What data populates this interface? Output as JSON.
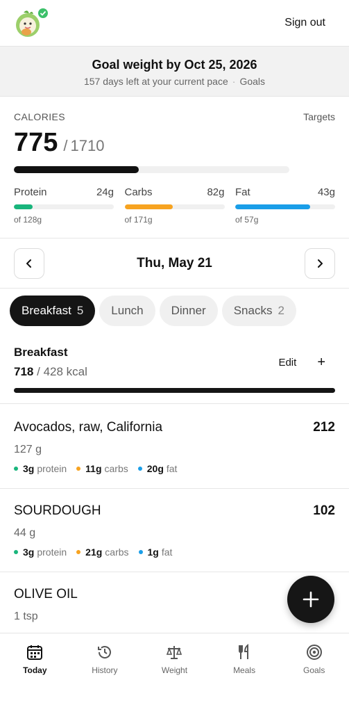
{
  "header": {
    "sign_out_label": "Sign out"
  },
  "goal_banner": {
    "title": "Goal weight by Oct 25, 2026",
    "subtitle": "157 days left at your current pace",
    "separator": "·",
    "goals_link": "Goals"
  },
  "calories": {
    "label": "CALORIES",
    "targets_link": "Targets",
    "consumed": "775",
    "slash": "/",
    "target": "1710",
    "progress": 0.453
  },
  "macros": [
    {
      "name": "Protein",
      "value": "24g",
      "of": "of 128g",
      "color": "#19b57c",
      "progress": 0.19
    },
    {
      "name": "Carbs",
      "value": "82g",
      "of": "of 171g",
      "color": "#f7a320",
      "progress": 0.48
    },
    {
      "name": "Fat",
      "value": "43g",
      "of": "of 57g",
      "color": "#1a9ee8",
      "progress": 0.75
    }
  ],
  "date_nav": {
    "date": "Thu, May 21"
  },
  "tabs": [
    {
      "label": "Breakfast",
      "count": "5"
    },
    {
      "label": "Lunch",
      "count": ""
    },
    {
      "label": "Dinner",
      "count": ""
    },
    {
      "label": "Snacks",
      "count": "2"
    }
  ],
  "meal": {
    "title": "Breakfast",
    "calories": "718",
    "separator": "/",
    "target": "428 kcal",
    "edit_label": "Edit",
    "add_label": "+"
  },
  "foods": [
    {
      "name": "Avocados, raw, California",
      "calories": "212",
      "quantity": "127 g",
      "protein": "3g",
      "carbs": "11g",
      "fat": "20g"
    },
    {
      "name": "SOURDOUGH",
      "calories": "102",
      "quantity": "44 g",
      "protein": "3g",
      "carbs": "21g",
      "fat": "1g"
    },
    {
      "name": "OLIVE OIL",
      "calories": "",
      "quantity": "1 tsp",
      "protein": "",
      "carbs": "",
      "fat": ""
    }
  ],
  "macro_words": {
    "protein": "protein",
    "carbs": "carbs",
    "fat": "fat"
  },
  "bottom_nav": [
    {
      "label": "Today",
      "icon": "calendar-icon"
    },
    {
      "label": "History",
      "icon": "history-icon"
    },
    {
      "label": "Weight",
      "icon": "scale-icon"
    },
    {
      "label": "Meals",
      "icon": "utensils-icon"
    },
    {
      "label": "Goals",
      "icon": "target-icon"
    }
  ],
  "colors": {
    "protein": "#19b57c",
    "carbs": "#f7a320",
    "fat": "#1a9ee8",
    "accent": "#151515"
  }
}
